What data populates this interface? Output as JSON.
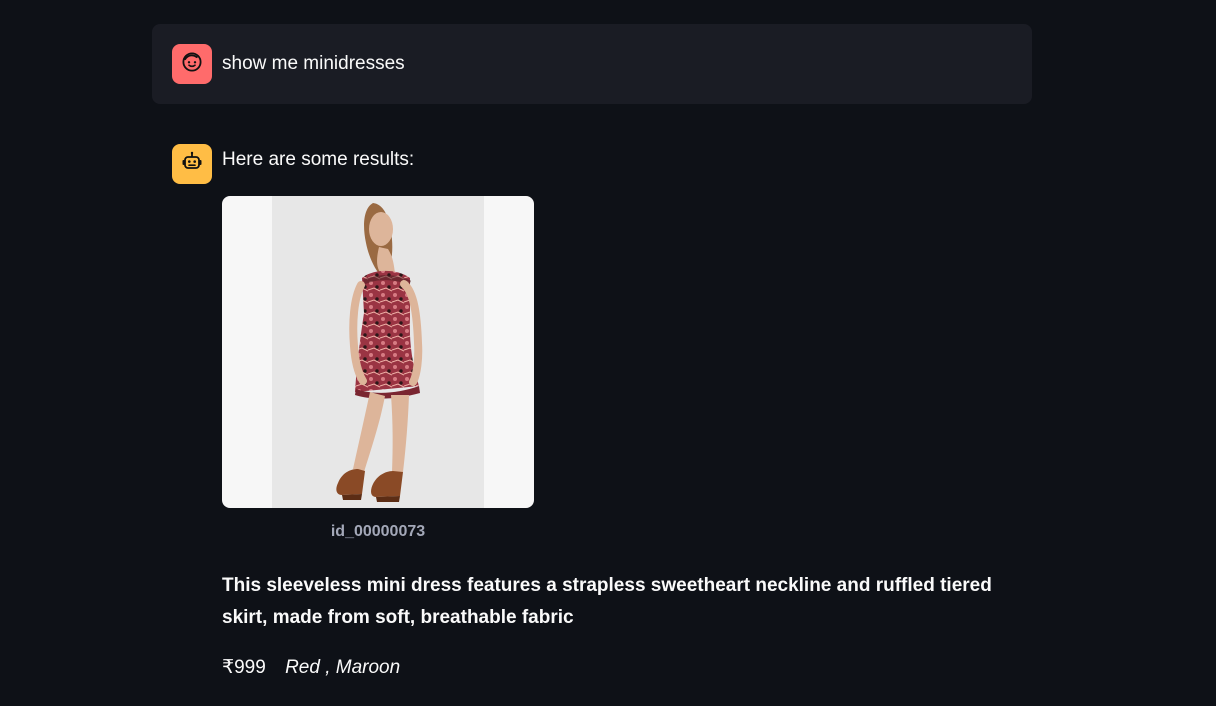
{
  "conversation": {
    "user_message": {
      "text": "show me minidresses",
      "avatar_icon": "face-icon",
      "avatar_color": "#ff6b6b"
    },
    "assistant_message": {
      "intro": "Here are some results:",
      "avatar_icon": "robot-icon",
      "avatar_color": "#ffbd45",
      "product": {
        "image_label": "id_00000073",
        "description": "This sleeveless mini dress features a strapless sweetheart neckline and ruffled tiered skirt, made from soft, breathable fabric",
        "price": "₹999",
        "colors": "Red , Maroon"
      }
    }
  },
  "theme": {
    "background": "#0e1117",
    "message_background": "#1a1c24",
    "text_primary": "#fafafa",
    "text_secondary": "#a3a8b8"
  }
}
